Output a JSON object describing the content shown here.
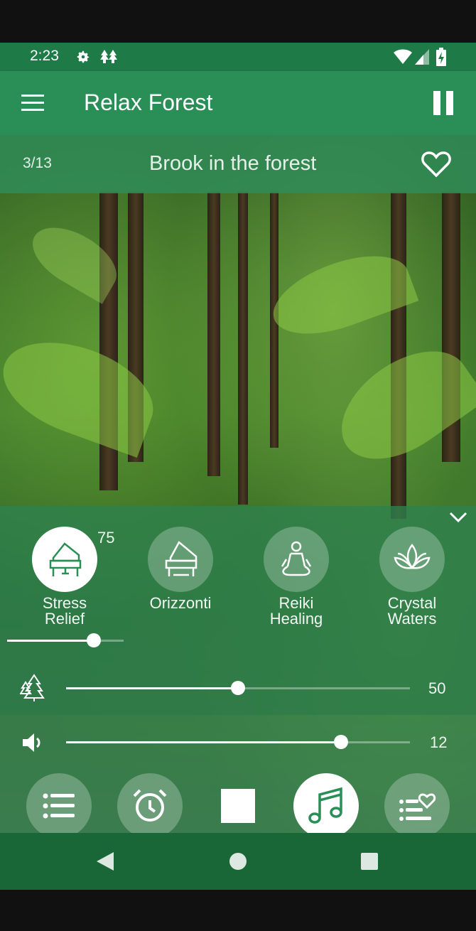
{
  "status_bar": {
    "time": "2:23",
    "icons": [
      "gear-icon",
      "trees-icon",
      "wifi-icon",
      "signal-icon",
      "battery-icon"
    ]
  },
  "app_bar": {
    "title": "Relax Forest",
    "menu_icon": "hamburger-icon",
    "action_icon": "pause-icon"
  },
  "track": {
    "counter": "3/13",
    "title": "Brook in the forest",
    "favorite_icon": "heart-outline-icon"
  },
  "music": {
    "collapse_icon": "chevron-down-icon",
    "selected_volume": "75",
    "selected_volume_level": 0.75,
    "items": [
      {
        "label_line1": "Stress",
        "label_line2": "Relief",
        "icon": "piano-icon",
        "active": true
      },
      {
        "label_line1": "Orizzonti",
        "label_line2": "",
        "icon": "grand-piano-icon",
        "active": false
      },
      {
        "label_line1": "Reiki",
        "label_line2": "Healing",
        "icon": "meditation-icon",
        "active": false
      },
      {
        "label_line1": "Crystal",
        "label_line2": "Waters",
        "icon": "lotus-icon",
        "active": false
      }
    ]
  },
  "nature_volume": {
    "icon": "trees-icon",
    "value": "50",
    "level": 0.5
  },
  "master_volume": {
    "icon": "speaker-icon",
    "value": "12",
    "level": 0.8
  },
  "toolbar": [
    "list-icon",
    "alarm-clock-icon",
    "stop-icon",
    "music-note-icon",
    "favorites-list-icon"
  ],
  "system_nav": [
    "back-icon",
    "home-icon",
    "recents-icon"
  ],
  "colors": {
    "status_bar": "#1e7a46",
    "app_bar": "#2a8f57",
    "system_nav": "#196636",
    "accent_white": "#ffffff"
  }
}
